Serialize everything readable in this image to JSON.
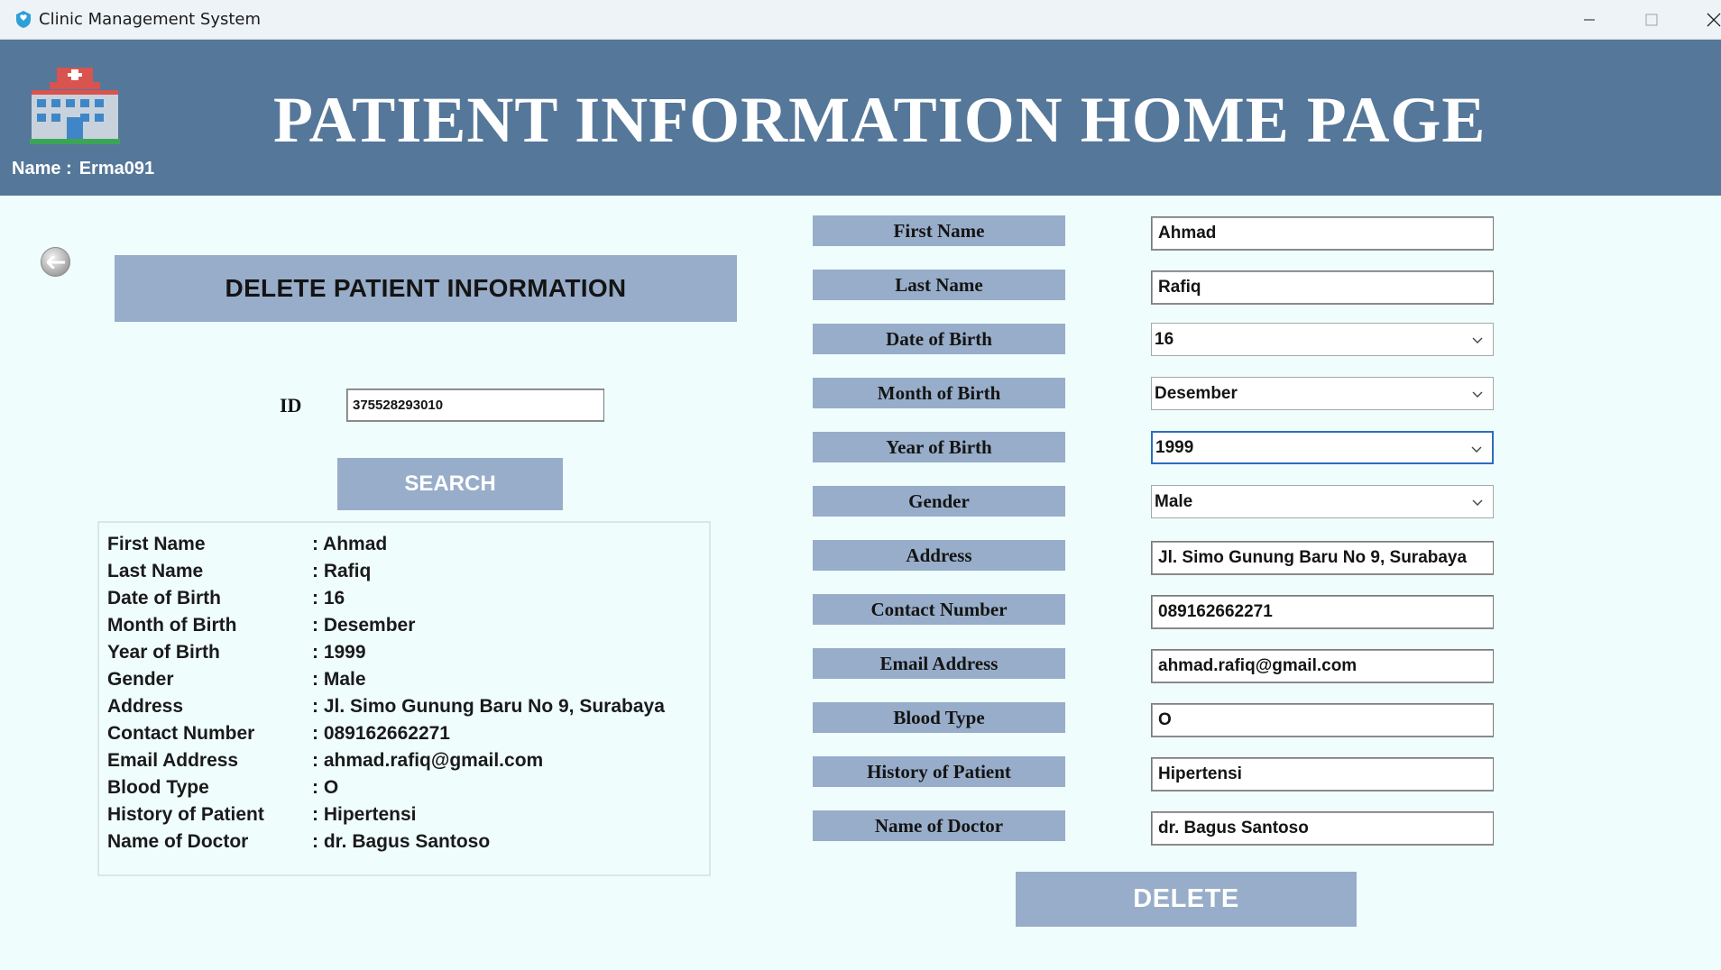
{
  "window": {
    "title": "Clinic Management System",
    "icons": [
      "app-icon",
      "minimize-icon",
      "maximize-icon",
      "close-icon"
    ]
  },
  "header": {
    "title": "PATIENT INFORMATION HOME PAGE",
    "user_label": "Name :",
    "user_name": "Erma091",
    "background": "#557799"
  },
  "left": {
    "banner": "DELETE PATIENT INFORMATION",
    "id_label": "ID",
    "id_value": "375528293010",
    "search_label": "SEARCH",
    "info": [
      {
        "key": "First Name",
        "value": ": Ahmad"
      },
      {
        "key": "Last Name",
        "value": ": Rafiq"
      },
      {
        "key": "Date of Birth",
        "value": ": 16"
      },
      {
        "key": "Month of Birth",
        "value": ": Desember"
      },
      {
        "key": "Year of Birth",
        "value": ": 1999"
      },
      {
        "key": "Gender",
        "value": ": Male"
      },
      {
        "key": "Address",
        "value": ": Jl. Simo Gunung Baru No 9, Surabaya"
      },
      {
        "key": "Contact Number",
        "value": ": 089162662271"
      },
      {
        "key": "Email Address",
        "value": ": ahmad.rafiq@gmail.com"
      },
      {
        "key": "Blood Type",
        "value": ": O"
      },
      {
        "key": "History of Patient",
        "value": ": Hipertensi"
      },
      {
        "key": "Name of Doctor",
        "value": ": dr. Bagus Santoso"
      }
    ]
  },
  "form": {
    "fields": [
      {
        "label": "First Name",
        "value": "Ahmad",
        "kind": "text"
      },
      {
        "label": "Last Name",
        "value": "Rafiq",
        "kind": "text"
      },
      {
        "label": "Date of Birth",
        "value": "16",
        "kind": "select"
      },
      {
        "label": "Month of Birth",
        "value": "Desember",
        "kind": "select"
      },
      {
        "label": "Year of Birth",
        "value": "1999",
        "kind": "select"
      },
      {
        "label": "Gender",
        "value": "Male",
        "kind": "select"
      },
      {
        "label": "Address",
        "value": "Jl. Simo Gunung Baru No 9, Surabaya",
        "kind": "text"
      },
      {
        "label": "Contact Number",
        "value": "089162662271",
        "kind": "text"
      },
      {
        "label": "Email Address",
        "value": "ahmad.rafiq@gmail.com",
        "kind": "text"
      },
      {
        "label": "Blood Type",
        "value": "O",
        "kind": "text"
      },
      {
        "label": "History of Patient",
        "value": "Hipertensi",
        "kind": "text"
      },
      {
        "label": "Name of Doctor",
        "value": "dr. Bagus Santoso",
        "kind": "text"
      }
    ],
    "delete_label": "DELETE"
  },
  "colors": {
    "header": "#557799",
    "accent": "#97adc9",
    "page_bg": "#f0fdfd"
  }
}
